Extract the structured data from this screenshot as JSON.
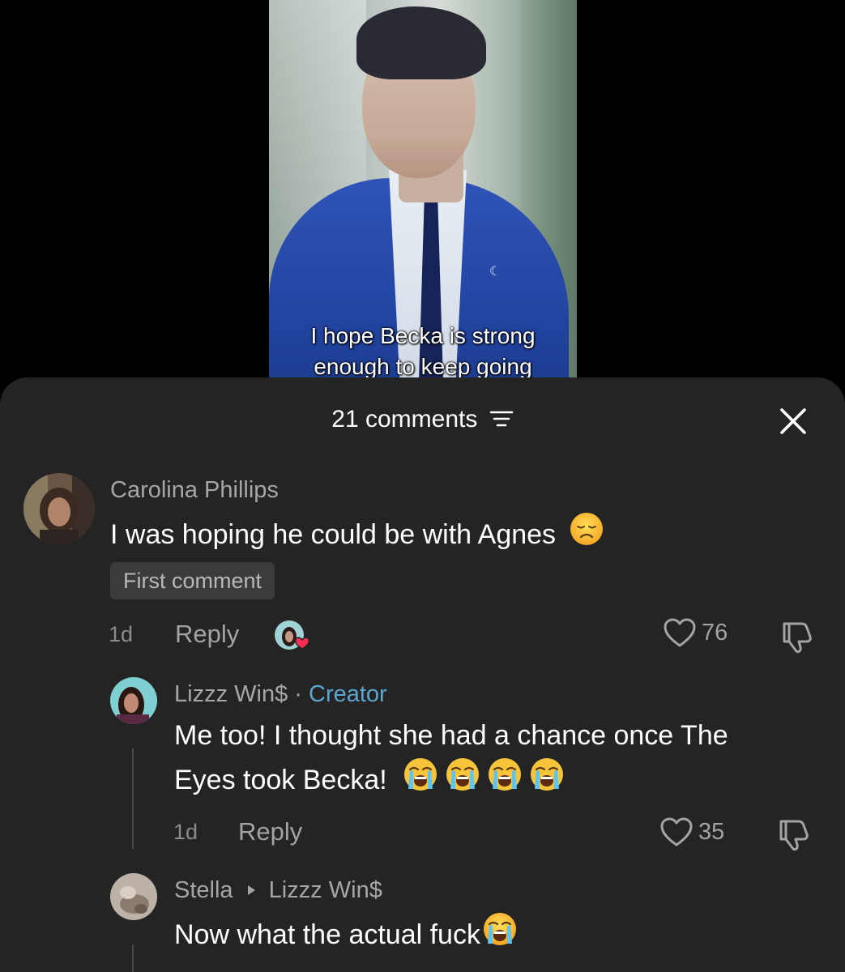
{
  "video": {
    "caption_line1": "I hope Becka is strong",
    "caption_line2": "enough to keep going"
  },
  "sheet": {
    "comment_count_label": "21 comments",
    "filter_icon": "filter-icon",
    "close_icon": "close-icon"
  },
  "comments": [
    {
      "username": "Carolina Phillips",
      "text": "I was hoping he could be with Agnes",
      "emoji": "disappointed-face",
      "badge": "First comment",
      "time": "1d",
      "reply_label": "Reply",
      "likes": "76",
      "creator_liked": true
    }
  ],
  "replies": [
    {
      "username": "Lizzz Win$",
      "separator": "·",
      "tag": "Creator",
      "text_line1": "Me too! I thought she had a chance once The",
      "text_line2": "Eyes took Becka!",
      "emoji": "loudly-crying-face",
      "emoji_count": 4,
      "time": "1d",
      "reply_label": "Reply",
      "likes": "35"
    },
    {
      "username": "Stella",
      "reply_to": "Lizzz Win$",
      "text": "Now what the actual fuck",
      "emoji": "loudly-crying-face"
    }
  ],
  "colors": {
    "sheet_bg": "#242424",
    "muted_text": "#a6a6a6",
    "creator_accent": "#5aa6cf",
    "liked_heart": "#fe2c55"
  }
}
